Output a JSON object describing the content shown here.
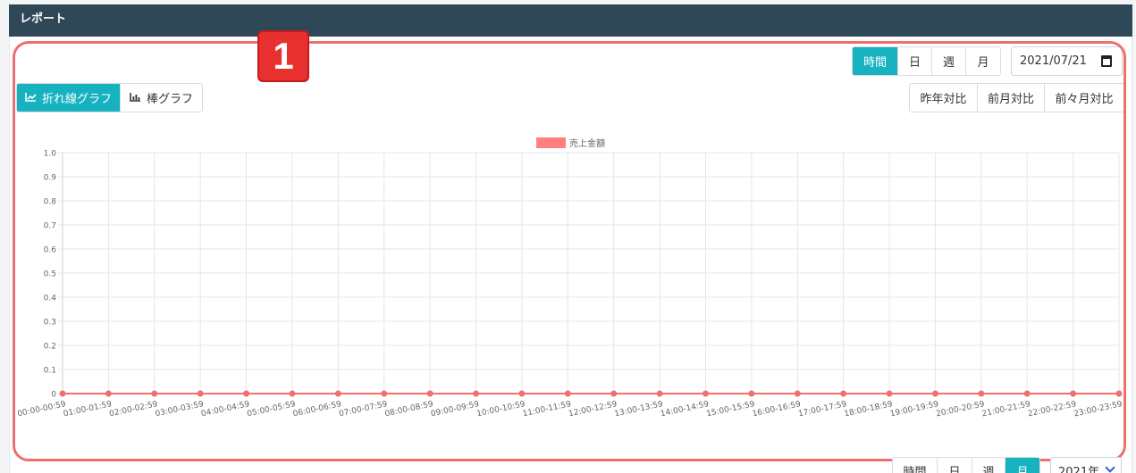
{
  "header": {
    "title": "レポート"
  },
  "period_tabs": [
    {
      "label": "時間",
      "active": true
    },
    {
      "label": "日",
      "active": false
    },
    {
      "label": "週",
      "active": false
    },
    {
      "label": "月",
      "active": false
    }
  ],
  "date_picker": {
    "value": "2021/07/21"
  },
  "chart_type_tabs": [
    {
      "label": "折れ線グラフ",
      "icon": "line-chart-icon",
      "active": true
    },
    {
      "label": "棒グラフ",
      "icon": "bar-chart-icon",
      "active": false
    }
  ],
  "compare_buttons": [
    {
      "label": "昨年対比"
    },
    {
      "label": "前月対比"
    },
    {
      "label": "前々月対比"
    }
  ],
  "annotation": {
    "number": "1"
  },
  "bottom_tabs": [
    {
      "label": "時間",
      "active": false
    },
    {
      "label": "日",
      "active": false
    },
    {
      "label": "週",
      "active": false
    },
    {
      "label": "月",
      "active": true
    }
  ],
  "year_select": {
    "value": "2021年"
  },
  "chart_data": {
    "type": "line",
    "categories": [
      "00:00-00:59",
      "01:00-01:59",
      "02:00-02:59",
      "03:00-03:59",
      "04:00-04:59",
      "05:00-05:59",
      "06:00-06:59",
      "07:00-07:59",
      "08:00-08:59",
      "09:00-09:59",
      "10:00-10:59",
      "11:00-11:59",
      "12:00-12:59",
      "13:00-13:59",
      "14:00-14:59",
      "15:00-15:59",
      "16:00-16:59",
      "17:00-17:59",
      "18:00-18:59",
      "19:00-19:59",
      "20:00-20:59",
      "21:00-21:59",
      "22:00-22:59",
      "23:00-23:59"
    ],
    "series": [
      {
        "name": "売上金額",
        "color": "#f07070",
        "values": [
          0,
          0,
          0,
          0,
          0,
          0,
          0,
          0,
          0,
          0,
          0,
          0,
          0,
          0,
          0,
          0,
          0,
          0,
          0,
          0,
          0,
          0,
          0,
          0
        ]
      }
    ],
    "yticks": [
      "0",
      "0.1",
      "0.2",
      "0.3",
      "0.4",
      "0.5",
      "0.6",
      "0.7",
      "0.8",
      "0.9",
      "1.0"
    ],
    "ylim": [
      0,
      1.0
    ],
    "grid": true,
    "legend": "top-center",
    "title": "",
    "xlabel": "",
    "ylabel": ""
  }
}
